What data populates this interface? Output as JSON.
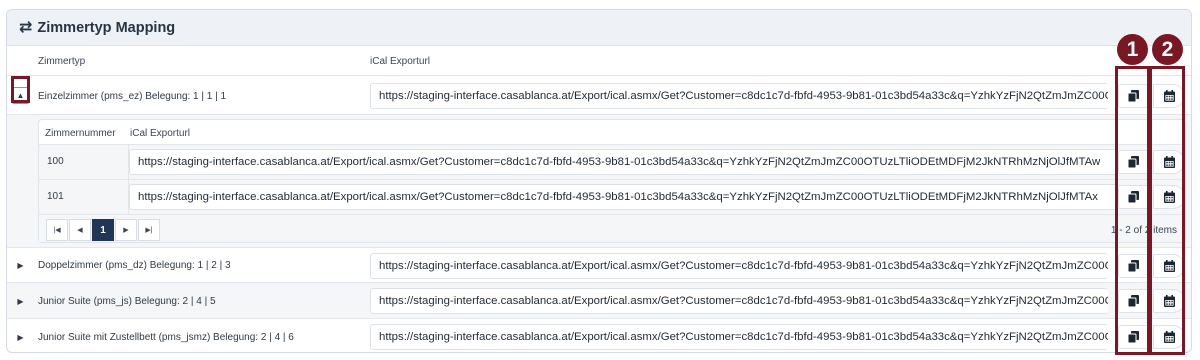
{
  "panel": {
    "title": "Zimmertyp Mapping",
    "icon": "swap-arrows-icon"
  },
  "grid": {
    "columns": [
      "Zimmertyp",
      "iCal Exporturl"
    ],
    "rows": [
      {
        "label": "Einzelzimmer (pms_ez) Belegung: 1 | 1 | 1",
        "url": "https://staging-interface.casablanca.at/Export/ical.asmx/Get?Customer=c8dc1c7d-fbfd-4953-9b81-01c3bd54a33c&q=YzhkYzFjN2QtZmJmZC00OTUzLTliODEtMDFjM2JkNTRhMzNjOlJfMTAw",
        "expanded": true
      },
      {
        "label": "Doppelzimmer (pms_dz) Belegung: 1 | 2 | 3",
        "url": "https://staging-interface.casablanca.at/Export/ical.asmx/Get?Customer=c8dc1c7d-fbfd-4953-9b81-01c3bd54a33c&q=YzhkYzFjN2QtZmJmZC00OTUzLTliODEtMDFjM2JkNTRhMzNjOlJfMTAw",
        "expanded": false
      },
      {
        "label": "Junior Suite (pms_js) Belegung: 2 | 4 | 5",
        "url": "https://staging-interface.casablanca.at/Export/ical.asmx/Get?Customer=c8dc1c7d-fbfd-4953-9b81-01c3bd54a33c&q=YzhkYzFjN2QtZmJmZC00OTUzLTliODEtMDFjM2JkNTRhMzNjOlJfMTAw",
        "expanded": false
      },
      {
        "label": "Junior Suite mit Zustellbett (pms_jsmz) Belegung: 2 | 4 | 6",
        "url": "https://staging-interface.casablanca.at/Export/ical.asmx/Get?Customer=c8dc1c7d-fbfd-4953-9b81-01c3bd54a33c&q=YzhkYzFjN2QtZmJmZC00OTUzLTliODEtMDFjM2JkNTRhMzNjOlJfMTAw",
        "expanded": false
      }
    ]
  },
  "detail": {
    "columns": [
      "Zimmernummer",
      "iCal Exporturl"
    ],
    "rows": [
      {
        "number": "100",
        "url": "https://staging-interface.casablanca.at/Export/ical.asmx/Get?Customer=c8dc1c7d-fbfd-4953-9b81-01c3bd54a33c&q=YzhkYzFjN2QtZmJmZC00OTUzLTliODEtMDFjM2JkNTRhMzNjOlJfMTAw"
      },
      {
        "number": "101",
        "url": "https://staging-interface.casablanca.at/Export/ical.asmx/Get?Customer=c8dc1c7d-fbfd-4953-9b81-01c3bd54a33c&q=YzhkYzFjN2QtZmJmZC00OTUzLTliODEtMDFjM2JkNTRhMzNjOlJfMTAx"
      }
    ],
    "pager": {
      "current_page": "1",
      "info": "1 - 2 of 2 items"
    }
  },
  "annotations": {
    "marker_1": "1",
    "marker_2": "2",
    "color": "#7a1725"
  },
  "icons": {
    "copy": "copy-icon",
    "calendar": "calendar-icon",
    "expanded": "caret-up-icon",
    "collapsed": "caret-right-icon"
  }
}
